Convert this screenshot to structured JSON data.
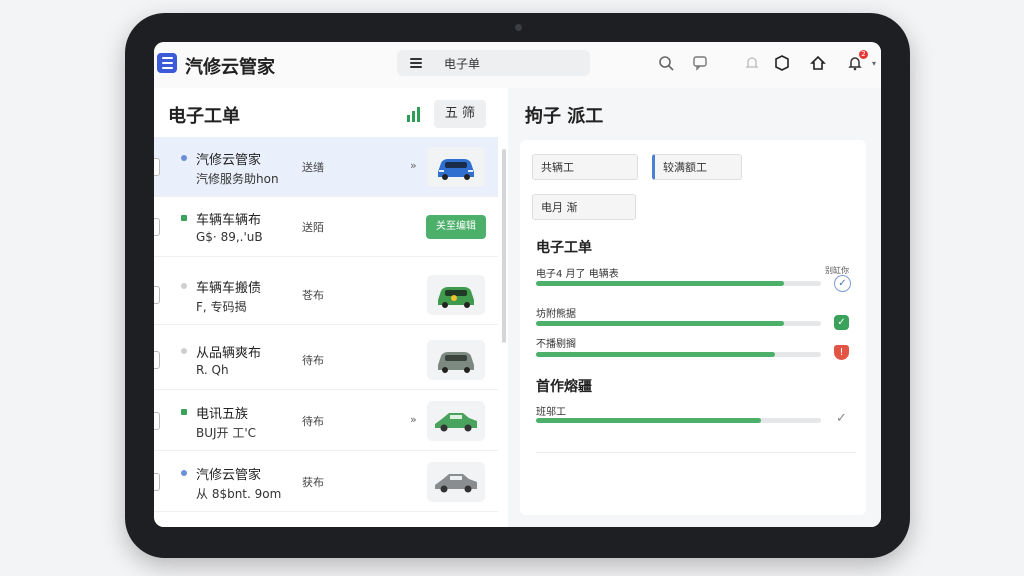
{
  "app": {
    "title": "汽修云管家",
    "search_label": "电子单"
  },
  "header_icons": [
    "search-icon",
    "chat-icon",
    "bell-outline-icon",
    "box-icon",
    "home-icon",
    "bell-icon"
  ],
  "notification_badge": "2",
  "left_panel": {
    "title": "电子工单",
    "button_label": "五 筛",
    "rows": [
      {
        "title": "汽修云管家",
        "sub": "汽修服务助hon",
        "tag": "送缮",
        "dot": "#6b8fd6",
        "selected": true,
        "chevron": "»",
        "thumb": "car-blue"
      },
      {
        "title": "车辆车辆布",
        "sub": "G$· 89,.'uB",
        "tag": "送陌",
        "dot": "#3aa25a",
        "action": "关至编辑"
      },
      {
        "title": "车辆车搬债",
        "sub": "F, 专码揭",
        "tag": "苍布",
        "dot": "#cfcfcf",
        "thumb": "car-green"
      },
      {
        "title": "从品辆爽布",
        "sub": "R. Qh",
        "tag": "待布",
        "dot": "#cfcfcf",
        "thumb": "car-gray"
      },
      {
        "title": "电讯五族",
        "sub": "BUJ开 工'C",
        "tag": "待布",
        "dot": "#3aa25a",
        "chevron": "»",
        "thumb": "car-green-sedan"
      },
      {
        "title": "汽修云管家",
        "sub": "从 8$bnt. 9om",
        "tag": "获布",
        "dot": "#6b8fd6",
        "thumb": "car-gray-sedan"
      }
    ]
  },
  "right_panel": {
    "title": "拘子 派工",
    "fields": [
      "共辆工",
      "较满额工",
      "电月 渐"
    ],
    "section1_title": "电子工单",
    "progress": [
      {
        "label": "电子4 月了 电辆表",
        "value": 0.87,
        "status": "circle-check"
      },
      {
        "label": "坊附熊据",
        "value": 0.87,
        "status": "green-check"
      },
      {
        "label": "不播剔搁",
        "value": 0.84,
        "status": "red-shield"
      }
    ],
    "status_caption": "别缸你",
    "section2_title": "首作熔疆",
    "progress2": [
      {
        "label": "班邬工",
        "value": 0.79,
        "status": "gray-check"
      }
    ]
  },
  "colors": {
    "accent_green": "#4caf6a",
    "brand_blue": "#3b5bd9",
    "selected_row": "#eaf0fb"
  }
}
